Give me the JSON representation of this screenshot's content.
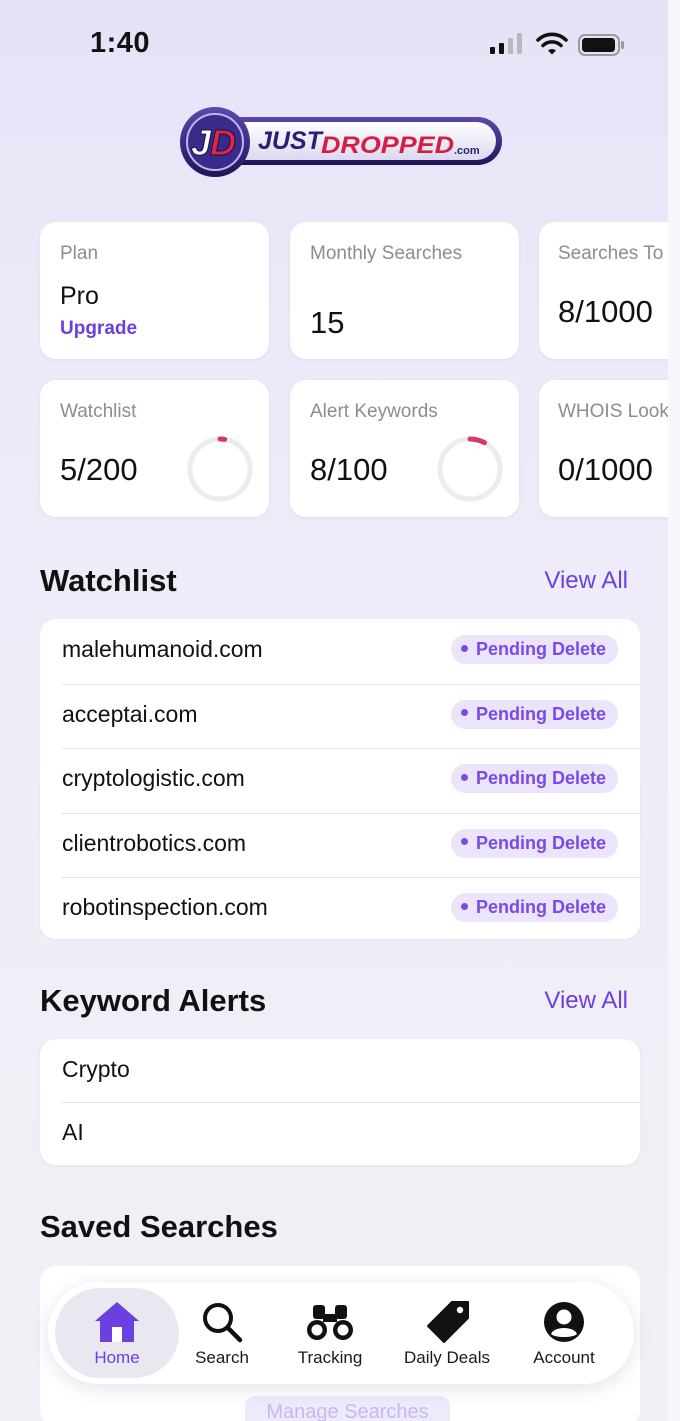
{
  "status_bar": {
    "time": "1:40"
  },
  "logo": {
    "mark": "JD",
    "text_just": "JUST",
    "text_dropped": "DROPPED",
    "text_tld": ".com"
  },
  "stats": [
    {
      "label": "Plan",
      "value": "Pro",
      "action": "Upgrade"
    },
    {
      "label": "Monthly Searches",
      "value": "15"
    },
    {
      "label": "Searches To",
      "value": "8/1000"
    },
    {
      "label": "Watchlist",
      "value": "5/200",
      "progress": 0.025
    },
    {
      "label": "Alert Keywords",
      "value": "8/100",
      "progress": 0.08
    },
    {
      "label": "WHOIS Look",
      "value": "0/1000"
    }
  ],
  "watchlist": {
    "title": "Watchlist",
    "view_all": "View All",
    "items": [
      {
        "domain": "malehumanoid.com",
        "status": "Pending Delete"
      },
      {
        "domain": "acceptai.com",
        "status": "Pending Delete"
      },
      {
        "domain": "cryptologistic.com",
        "status": "Pending Delete"
      },
      {
        "domain": "clientrobotics.com",
        "status": "Pending Delete"
      },
      {
        "domain": "robotinspection.com",
        "status": "Pending Delete"
      }
    ]
  },
  "keyword_alerts": {
    "title": "Keyword Alerts",
    "view_all": "View All",
    "items": [
      "Crypto",
      "AI"
    ]
  },
  "saved_searches": {
    "title": "Saved Searches",
    "manage_label": "Manage Searches"
  },
  "tabbar": {
    "items": [
      {
        "label": "Home",
        "icon": "home-icon",
        "active": true
      },
      {
        "label": "Search",
        "icon": "search-icon"
      },
      {
        "label": "Tracking",
        "icon": "binoculars-icon"
      },
      {
        "label": "Daily Deals",
        "icon": "tag-icon"
      },
      {
        "label": "Account",
        "icon": "account-icon"
      }
    ]
  },
  "colors": {
    "accent": "#6b3fe0",
    "ring": "#d5386a",
    "badge_bg": "#ebe4fb"
  }
}
